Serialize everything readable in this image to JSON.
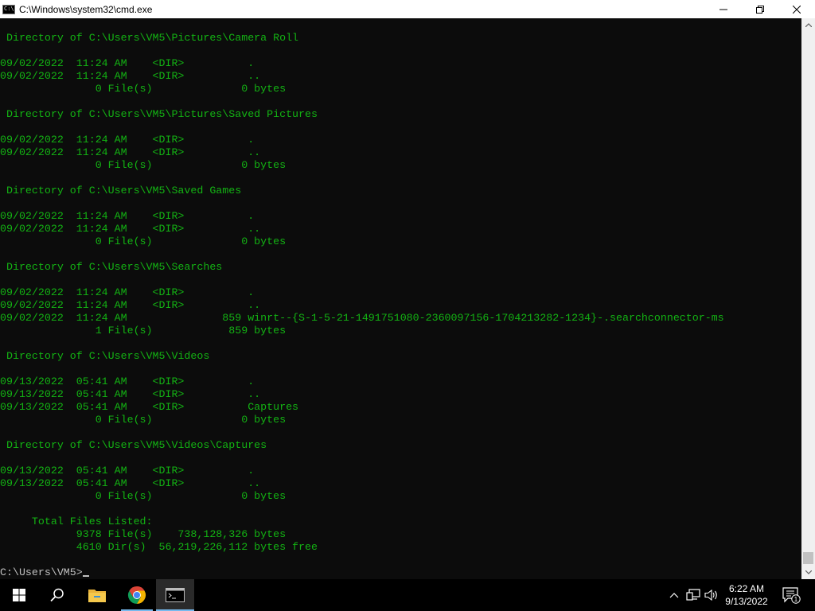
{
  "window": {
    "title": "C:\\Windows\\system32\\cmd.exe",
    "icon_text": "C:\\"
  },
  "console_lines": [
    " Directory of C:\\Users\\VM5\\Pictures\\Camera Roll",
    "",
    "09/02/2022  11:24 AM    <DIR>          .",
    "09/02/2022  11:24 AM    <DIR>          ..",
    "               0 File(s)              0 bytes",
    "",
    " Directory of C:\\Users\\VM5\\Pictures\\Saved Pictures",
    "",
    "09/02/2022  11:24 AM    <DIR>          .",
    "09/02/2022  11:24 AM    <DIR>          ..",
    "               0 File(s)              0 bytes",
    "",
    " Directory of C:\\Users\\VM5\\Saved Games",
    "",
    "09/02/2022  11:24 AM    <DIR>          .",
    "09/02/2022  11:24 AM    <DIR>          ..",
    "               0 File(s)              0 bytes",
    "",
    " Directory of C:\\Users\\VM5\\Searches",
    "",
    "09/02/2022  11:24 AM    <DIR>          .",
    "09/02/2022  11:24 AM    <DIR>          ..",
    "09/02/2022  11:24 AM               859 winrt--{S-1-5-21-1491751080-2360097156-1704213282-1234}-.searchconnector-ms",
    "               1 File(s)            859 bytes",
    "",
    " Directory of C:\\Users\\VM5\\Videos",
    "",
    "09/13/2022  05:41 AM    <DIR>          .",
    "09/13/2022  05:41 AM    <DIR>          ..",
    "09/13/2022  05:41 AM    <DIR>          Captures",
    "               0 File(s)              0 bytes",
    "",
    " Directory of C:\\Users\\VM5\\Videos\\Captures",
    "",
    "09/13/2022  05:41 AM    <DIR>          .",
    "09/13/2022  05:41 AM    <DIR>          ..",
    "               0 File(s)              0 bytes",
    "",
    "     Total Files Listed:",
    "            9378 File(s)    738,128,326 bytes",
    "            4610 Dir(s)  56,219,226,112 bytes free",
    ""
  ],
  "prompt": "C:\\Users\\VM5>",
  "taskbar": {
    "apps": [
      "start",
      "search",
      "file-explorer",
      "chrome",
      "command-prompt"
    ],
    "clock_time": "6:22 AM",
    "clock_date": "9/13/2022",
    "notification_count": "1"
  },
  "colors": {
    "console_text": "#13b313",
    "console_bg": "#0c0c0c",
    "taskbar_bg": "#000000",
    "accent": "#76b9ed"
  }
}
